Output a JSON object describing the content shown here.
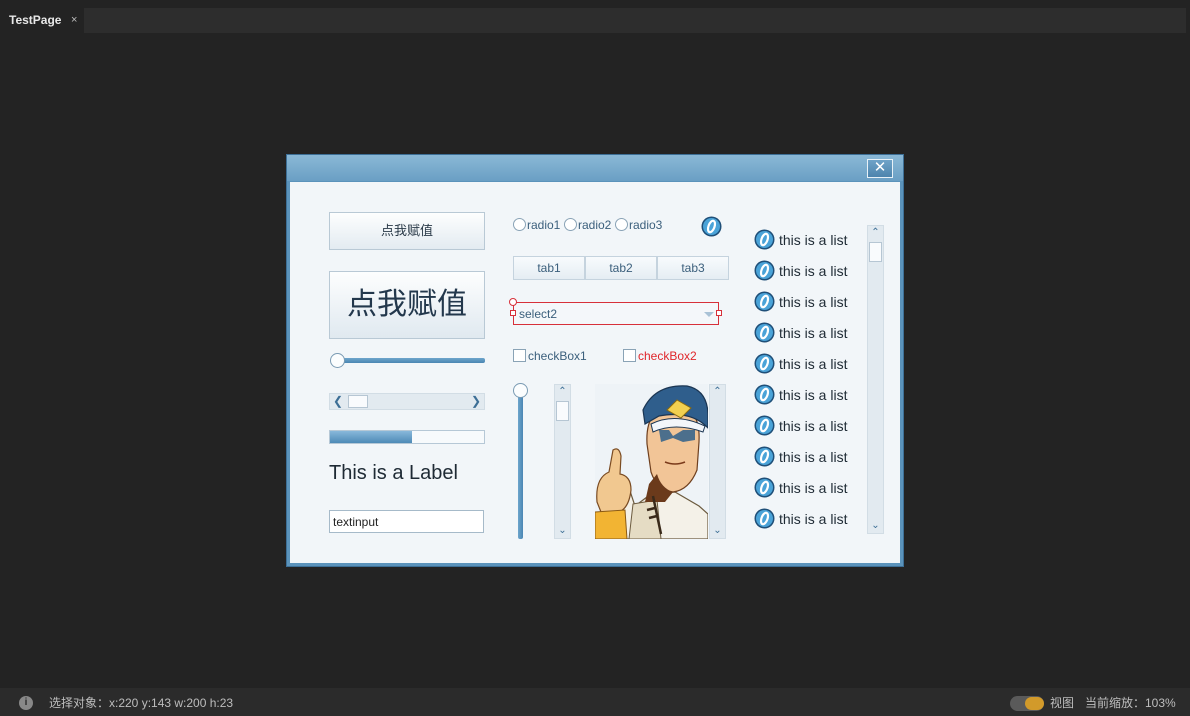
{
  "document_tab": {
    "title": "TestPage",
    "close": "×"
  },
  "dialog": {
    "close": "✕",
    "buttons": {
      "small": "点我赋值",
      "large": "点我赋值"
    },
    "slider": {
      "value": 0
    },
    "scrollbar": {
      "left_arrow": "❮",
      "right_arrow": "❯"
    },
    "progress": {
      "value": 0.53
    },
    "label": "This is a Label",
    "textinput": {
      "value": "textinput"
    },
    "radios": [
      "radio1",
      "radio2",
      "radio3"
    ],
    "tabs": [
      "tab1",
      "tab2",
      "tab3"
    ],
    "select": {
      "value": "select2"
    },
    "checkboxes": [
      {
        "label": "checkBox1",
        "color": "#3b5f7c"
      },
      {
        "label": "checkBox2",
        "color": "#e0262b"
      }
    ],
    "vscroll": {
      "up_arrow": "⌃",
      "down_arrow": "⌄"
    },
    "list": {
      "items": [
        "this is a list",
        "this is a list",
        "this is a list",
        "this is a list",
        "this is a list",
        "this is a list",
        "this is a list",
        "this is a list",
        "this is a list",
        "this is a list"
      ],
      "icon": "ring-badge-icon"
    }
  },
  "statusbar": {
    "info_icon": "i",
    "selection": "选择对象：x:220 y:143  w:200 h:23",
    "view_label": "视图",
    "zoom": "当前缩放：103%"
  },
  "colors": {
    "accent": "#4a86b3",
    "selection_border": "#d7303a",
    "toggle": "#d29a2a"
  }
}
